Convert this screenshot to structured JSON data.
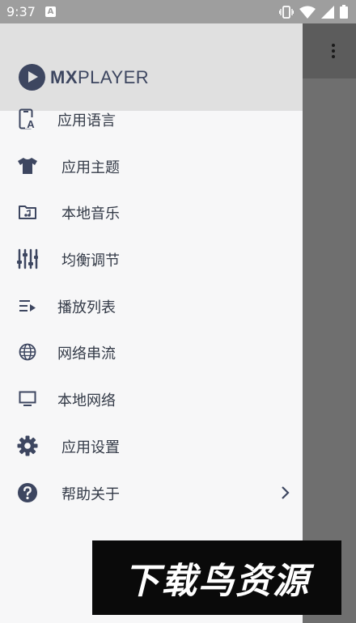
{
  "status_bar": {
    "time": "9:37",
    "notification_glyph": "A",
    "icons": [
      "vibrate-icon",
      "wifi-icon",
      "signal-icon",
      "battery-icon"
    ]
  },
  "drawer": {
    "logo_mx": "MX",
    "logo_player": "PLAYER",
    "items": [
      {
        "label": "应用语言",
        "icon": "app-language-icon"
      },
      {
        "label": "应用主题",
        "icon": "tshirt-theme-icon"
      },
      {
        "label": "本地音乐",
        "icon": "music-folder-icon"
      },
      {
        "label": "均衡调节",
        "icon": "equalizer-icon"
      },
      {
        "label": "播放列表",
        "icon": "playlist-icon"
      },
      {
        "label": "网络串流",
        "icon": "globe-icon"
      },
      {
        "label": "本地网络",
        "icon": "monitor-icon"
      },
      {
        "label": "应用设置",
        "icon": "gear-icon"
      },
      {
        "label": "帮助关于",
        "icon": "help-icon",
        "has_chevron": true
      }
    ]
  },
  "watermark": "下载鸟资源",
  "colors": {
    "accent": "#3d4660",
    "drawer_bg": "#f7f7f8",
    "header_bg": "#e0e0e0",
    "status_bar": "#9e9e9e",
    "scrim": "#6f6f6f"
  }
}
